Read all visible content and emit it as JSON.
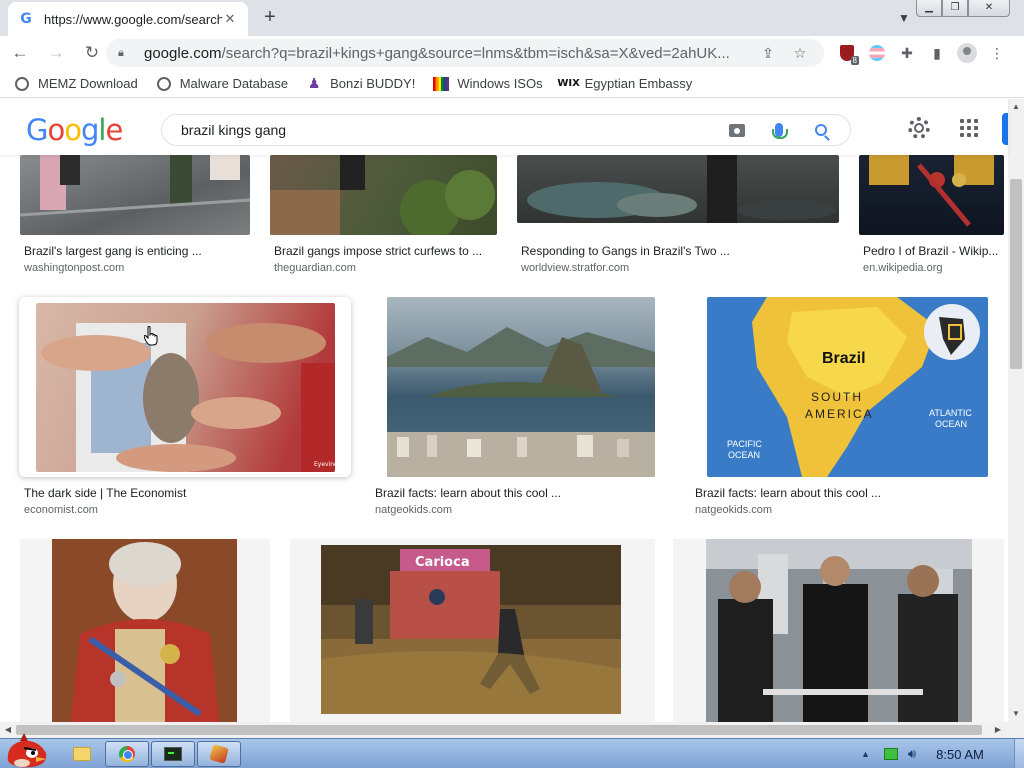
{
  "browser": {
    "tab": {
      "title": "https://www.google.com/search",
      "favicon": "G"
    },
    "url": {
      "host": "google.com",
      "rest": "/search?q=brazil+kings+gang&source=lnms&tbm=isch&sa=X&ved=2ahUK..."
    },
    "bookmarks": [
      {
        "label": "MEMZ Download",
        "icon": "globe-icon"
      },
      {
        "label": "Malware Database",
        "icon": "globe-icon"
      },
      {
        "label": "Bonzi BUDDY!",
        "icon": "bonzi-icon"
      },
      {
        "label": "Windows ISOs",
        "icon": "windows-flag-icon"
      },
      {
        "label": "Egyptian Embassy",
        "icon": "wix-icon"
      }
    ],
    "extension_badge": "8",
    "wix_label": "WIX"
  },
  "google": {
    "logo": "Google",
    "query": "brazil kings gang"
  },
  "results": {
    "row1": [
      {
        "caption": "Brazil's largest gang is enticing ...",
        "source": "washingtonpost.com",
        "color": "#6b6f72"
      },
      {
        "caption": "Brazil gangs impose strict curfews to ...",
        "source": "theguardian.com",
        "color": "#5b5a4c"
      },
      {
        "caption": "Responding to Gangs in Brazil's Two ...",
        "source": "worldview.stratfor.com",
        "color": "#3f4a4a"
      },
      {
        "caption": "Pedro I of Brazil - Wikip...",
        "source": "en.wikipedia.org",
        "color": "#1c2230"
      }
    ],
    "row2": [
      {
        "caption": "The dark side | The Economist",
        "source": "economist.com",
        "color": "#c9a99a"
      },
      {
        "caption": "Brazil facts: learn about this cool ...",
        "source": "natgeokids.com",
        "color": "#5e7d8f"
      },
      {
        "caption": "Brazil facts: learn about this cool ...",
        "source": "natgeokids.com",
        "color": "#3a7bc8"
      }
    ],
    "row3": [
      {
        "color": "#a83a2a"
      },
      {
        "color": "#6b5430"
      },
      {
        "color": "#6f7378"
      }
    ],
    "map_labels": {
      "country": "Brazil",
      "continent1": "SOUTH",
      "continent2": "AMERICA",
      "atlantic1": "ATLANTIC",
      "atlantic2": "OCEAN",
      "pacific1": "PACIFIC",
      "pacific2": "OCEAN"
    }
  },
  "taskbar": {
    "clock": "8:50 AM"
  }
}
